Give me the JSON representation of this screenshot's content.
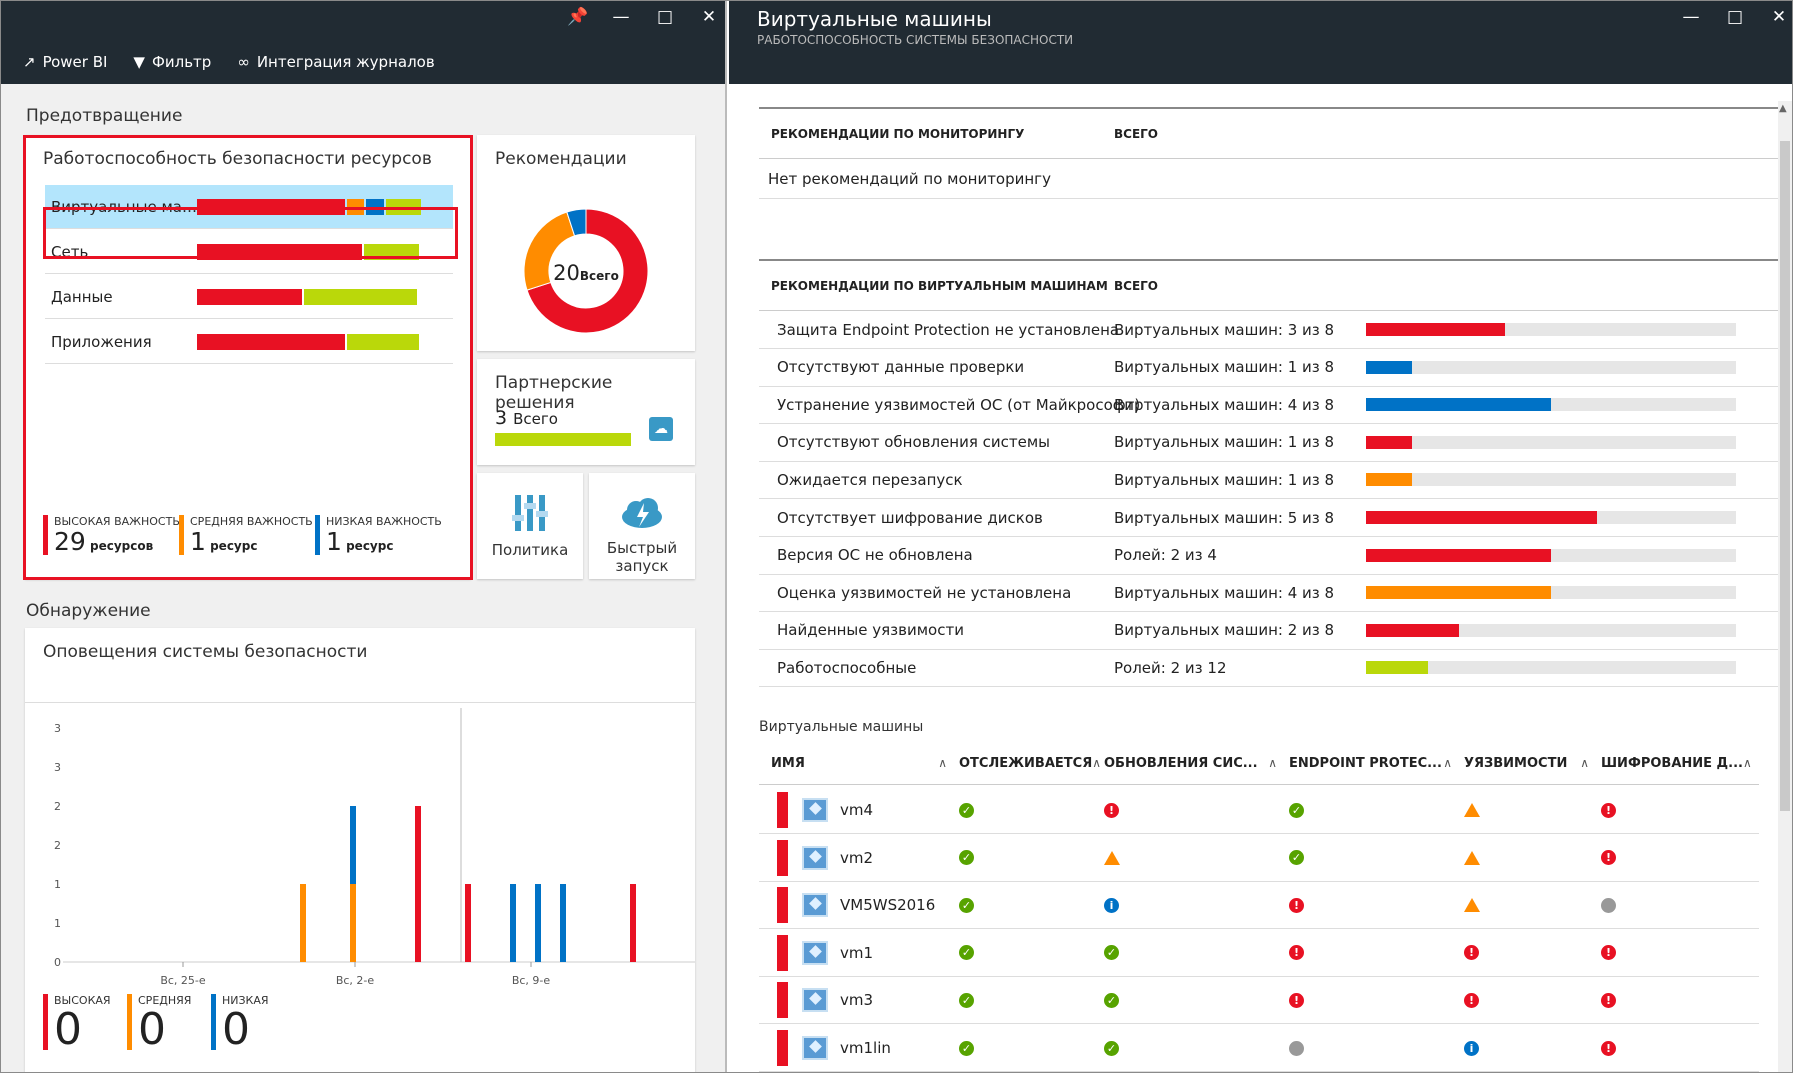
{
  "left_pane": {
    "toolbar": [
      {
        "label": "Power BI",
        "icon": "external-link-icon"
      },
      {
        "label": "Фильтр",
        "icon": "filter-icon"
      },
      {
        "label": "Интеграция журналов",
        "icon": "link-icon"
      }
    ],
    "prevention_title": "Предотвращение",
    "detection_title": "Обнаружение",
    "health_card": {
      "title": "Работоспособность безопасности ресурсов",
      "rows": [
        {
          "label": "Виртуальные маш...",
          "segments": [
            {
              "frac": 0.59,
              "color": "#e81123"
            },
            {
              "frac": 0.07,
              "color": "#ff8c00"
            },
            {
              "frac": 0.07,
              "color": "#0072c6"
            },
            {
              "frac": 0.14,
              "color": "#bad80a"
            }
          ],
          "selected": true
        },
        {
          "label": "Сеть",
          "segments": [
            {
              "frac": 0.66,
              "color": "#e81123"
            },
            {
              "frac": 0.22,
              "color": "#bad80a"
            }
          ],
          "selected": false
        },
        {
          "label": "Данные",
          "segments": [
            {
              "frac": 0.42,
              "color": "#e81123"
            },
            {
              "frac": 0.45,
              "color": "#bad80a"
            }
          ],
          "selected": false
        },
        {
          "label": "Приложения",
          "segments": [
            {
              "frac": 0.59,
              "color": "#e81123"
            },
            {
              "frac": 0.29,
              "color": "#bad80a"
            }
          ],
          "selected": false
        }
      ],
      "severity": [
        {
          "title": "ВЫСОКАЯ ВАЖНОСТЬ",
          "count": "29",
          "unit": "ресурсов",
          "color": "#e81123"
        },
        {
          "title": "СРЕДНЯЯ ВАЖНОСТЬ",
          "count": "1",
          "unit": "ресурс",
          "color": "#ff8c00"
        },
        {
          "title": "НИЗКАЯ ВАЖНОСТЬ",
          "count": "1",
          "unit": "ресурс",
          "color": "#0072c6"
        }
      ]
    },
    "recommendations_card": {
      "title": "Рекомендации",
      "total": "20",
      "total_unit": "Всего",
      "donut": [
        {
          "value": 14,
          "color": "#e81123"
        },
        {
          "value": 5,
          "color": "#ff8c00"
        },
        {
          "value": 1,
          "color": "#0072c6"
        }
      ]
    },
    "partners_card": {
      "title": "Партнерские решения",
      "count": "3",
      "unit": "Всего",
      "icon": "store-bag-icon"
    },
    "policy_tile": {
      "label": "Политика",
      "icon": "sliders-icon"
    },
    "quickstart_tile": {
      "label_line1": "Быстрый",
      "label_line2": "запуск",
      "icon": "cloud-bolt-icon"
    },
    "alerts_card": {
      "title": "Оповещения системы безопасности",
      "legend": [
        {
          "label": "ВЫСОКАЯ",
          "count": "0",
          "color": "#e81123"
        },
        {
          "label": "СРЕДНЯЯ",
          "count": "0",
          "color": "#ff8c00"
        },
        {
          "label": "НИЗКАЯ",
          "count": "0",
          "color": "#0072c6"
        }
      ]
    }
  },
  "chart_data": {
    "type": "bar",
    "stacked": true,
    "title": "Оповещения системы безопасности",
    "y_tick_labels": [
      "0",
      "1",
      "1",
      "2",
      "2",
      "3",
      "3"
    ],
    "ylim": [
      0,
      3
    ],
    "x_tick_labels": [
      "Вс, 25-е",
      "Вс, 2-е",
      "Вс, 9-е"
    ],
    "x": [
      "01-28",
      "01-29",
      "01-30",
      "01-31",
      "02-01",
      "02-02",
      "02-03",
      "02-04",
      "02-05",
      "02-06",
      "02-07",
      "02-08",
      "02-09",
      "02-10",
      "02-11",
      "02-12",
      "02-13",
      "02-14",
      "02-15",
      "02-16"
    ],
    "series": [
      {
        "color": "#ff8c00",
        "values": [
          1,
          0,
          1,
          0,
          0,
          0,
          0,
          0,
          0,
          0,
          0,
          0,
          0,
          0,
          0,
          0,
          0,
          0,
          0,
          0
        ]
      },
      {
        "color": "#0072c6",
        "values": [
          0,
          0,
          1,
          0,
          0,
          0,
          0,
          0,
          0,
          0,
          1,
          1,
          1,
          0,
          0,
          0,
          0,
          0,
          0,
          0
        ]
      },
      {
        "color": "#e81123",
        "values": [
          0,
          0,
          0,
          0,
          2,
          0,
          0,
          1,
          0,
          1,
          0,
          0,
          0,
          0,
          0,
          1,
          0,
          0,
          0,
          0
        ]
      }
    ],
    "grid": false
  },
  "right_pane": {
    "title": "Виртуальные машины",
    "subtitle": "РАБОТОСПОСОБНОСТЬ СИСТЕМЫ БЕЗОПАСНОСТИ",
    "monitoring": {
      "col1": "РЕКОМЕНДАЦИИ ПО МОНИТОРИНГУ",
      "col2": "ВСЕГО",
      "empty": "Нет рекомендаций по мониторингу"
    },
    "vm_recs": {
      "col1": "РЕКОМЕНДАЦИИ ПО ВИРТУАЛЬНЫМ МАШИНАМ",
      "col2": "ВСЕГО",
      "rows": [
        {
          "name": "Защита Endpoint Protection не установлена",
          "total": "Виртуальных машин: 3 из 8",
          "frac": 0.375,
          "color": "#e81123"
        },
        {
          "name": "Отсутствуют данные проверки",
          "total": "Виртуальных машин: 1 из 8",
          "frac": 0.125,
          "color": "#0072c6"
        },
        {
          "name": "Устранение уязвимостей ОС (от Майкрософт)",
          "total": "Виртуальных машин: 4 из 8",
          "frac": 0.5,
          "color": "#0072c6"
        },
        {
          "name": "Отсутствуют обновления системы",
          "total": "Виртуальных машин: 1 из 8",
          "frac": 0.125,
          "color": "#e81123"
        },
        {
          "name": "Ожидается перезапуск",
          "total": "Виртуальных машин: 1 из 8",
          "frac": 0.125,
          "color": "#ff8c00"
        },
        {
          "name": "Отсутствует шифрование дисков",
          "total": "Виртуальных машин: 5 из 8",
          "frac": 0.625,
          "color": "#e81123"
        },
        {
          "name": "Версия ОС не обновлена",
          "total": "Ролей: 2 из 4",
          "frac": 0.5,
          "color": "#e81123"
        },
        {
          "name": "Оценка уязвимостей не установлена",
          "total": "Виртуальных машин: 4 из 8",
          "frac": 0.5,
          "color": "#ff8c00"
        },
        {
          "name": "Найденные уязвимости",
          "total": "Виртуальных машин: 2 из 8",
          "frac": 0.25,
          "color": "#e81123"
        },
        {
          "name": "Работоспособные",
          "total": "Ролей: 2 из 12",
          "frac": 0.167,
          "color": "#bad80a"
        }
      ]
    },
    "vm_table": {
      "section_title": "Виртуальные машины",
      "columns": [
        "ИМЯ",
        "ОТСЛЕЖИВАЕТСЯ",
        "ОБНОВЛЕНИЯ СИС...",
        "ENDPOINT PROTEC...",
        "УЯЗВИМОСТИ",
        "ШИФРОВАНИЕ Д..."
      ],
      "rows": [
        {
          "name": "vm4",
          "status": [
            "ok",
            "err",
            "ok",
            "warn",
            "err"
          ]
        },
        {
          "name": "vm2",
          "status": [
            "ok",
            "warn",
            "ok",
            "warn",
            "err"
          ]
        },
        {
          "name": "VM5WS2016",
          "status": [
            "ok",
            "info",
            "err",
            "warn",
            "na"
          ]
        },
        {
          "name": "vm1",
          "status": [
            "ok",
            "ok",
            "err",
            "err",
            "err"
          ]
        },
        {
          "name": "vm3",
          "status": [
            "ok",
            "ok",
            "err",
            "err",
            "err"
          ]
        },
        {
          "name": "vm1lin",
          "status": [
            "ok",
            "ok",
            "na",
            "info",
            "err"
          ]
        }
      ]
    }
  }
}
